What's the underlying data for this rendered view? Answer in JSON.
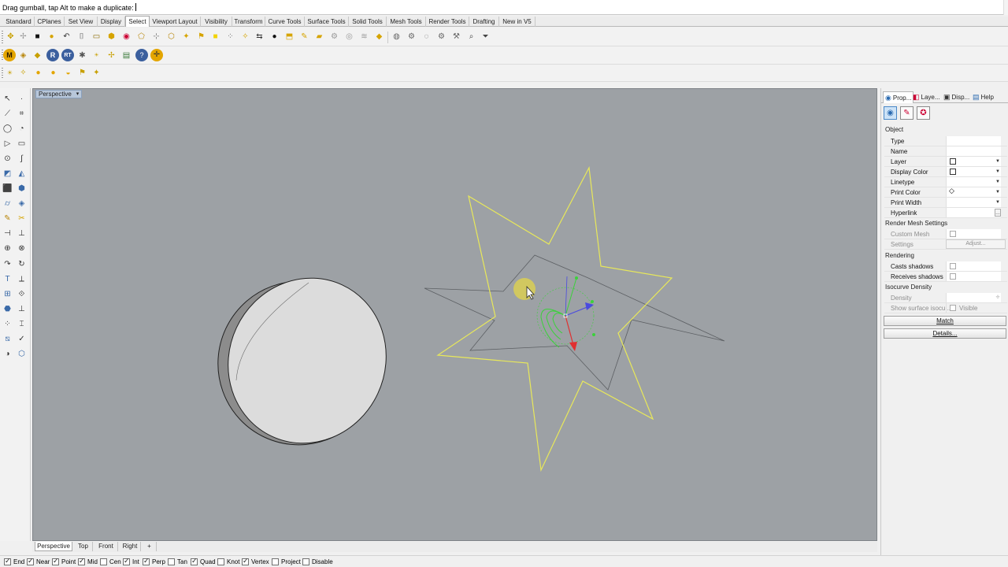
{
  "command_line": {
    "prompt": "Drag gumball, tap Alt to make a duplicate:"
  },
  "tabs": [
    "Standard",
    "CPlanes",
    "Set View",
    "Display",
    "Select",
    "Viewport Layout",
    "Visibility",
    "Transform",
    "Curve Tools",
    "Surface Tools",
    "Solid Tools",
    "Mesh Tools",
    "Render Tools",
    "Drafting",
    "New in V5"
  ],
  "active_tab": "Select",
  "viewport": {
    "title": "Perspective",
    "title_arrow": "▾"
  },
  "viewport_tabs": [
    "Perspective",
    "Top",
    "Front",
    "Right",
    "+"
  ],
  "osnap": [
    {
      "label": "End",
      "checked": true
    },
    {
      "label": "Near",
      "checked": true
    },
    {
      "label": "Point",
      "checked": true
    },
    {
      "label": "Mid",
      "checked": true
    },
    {
      "label": "Cen",
      "checked": false
    },
    {
      "label": "Int",
      "checked": true
    },
    {
      "label": "Perp",
      "checked": true
    },
    {
      "label": "Tan",
      "checked": false
    },
    {
      "label": "Quad",
      "checked": true
    },
    {
      "label": "Knot",
      "checked": false
    },
    {
      "label": "Vertex",
      "checked": true
    },
    {
      "label": "Project",
      "checked": false
    },
    {
      "label": "Disable",
      "checked": false
    }
  ],
  "panel": {
    "tabs": [
      {
        "label": "Prop...",
        "icon": "properties-icon"
      },
      {
        "label": "Laye...",
        "icon": "layers-icon"
      },
      {
        "label": "Disp...",
        "icon": "display-icon"
      },
      {
        "label": "Help",
        "icon": "help-icon"
      }
    ],
    "sections": {
      "object": "Object",
      "render_mesh": "Render Mesh Settings",
      "rendering": "Rendering",
      "isocurve": "Isocurve Density"
    },
    "object_rows": [
      "Type",
      "Name",
      "Layer",
      "Display Color",
      "Linetype",
      "Print Color",
      "Print Width",
      "Hyperlink"
    ],
    "render_mesh_rows": {
      "custom_mesh": "Custom Mesh",
      "settings": "Settings",
      "adjust": "Adjust..."
    },
    "rendering_rows": [
      "Casts shadows",
      "Receives shadows"
    ],
    "isocurve_rows": {
      "density": "Density",
      "show_surface": "Show surface isocu...",
      "visible": "Visible"
    },
    "buttons": {
      "match": "Match",
      "details": "Details..."
    }
  }
}
